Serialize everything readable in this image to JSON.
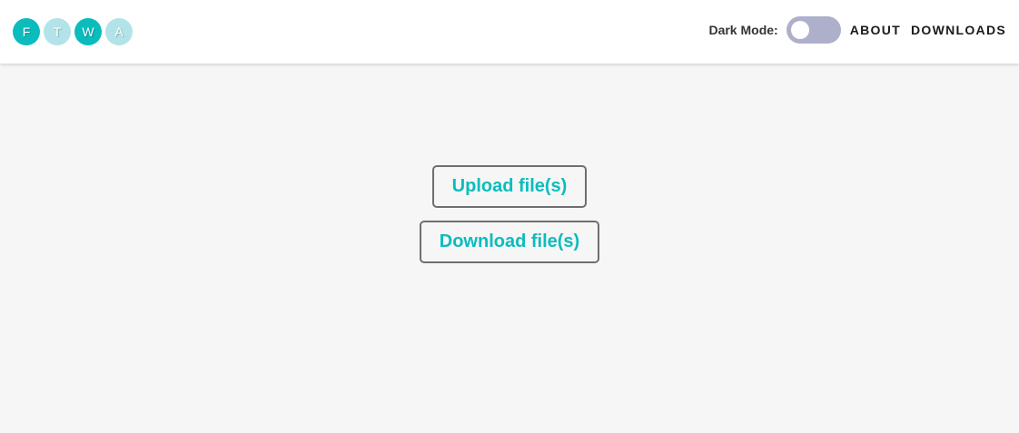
{
  "logo": {
    "letters": [
      "F",
      "T",
      "W",
      "A"
    ],
    "colors": [
      "#0bbcbd",
      "#b2e3e8"
    ]
  },
  "header": {
    "dark_mode_label": "Dark Mode:",
    "dark_mode_enabled": false,
    "nav": {
      "about": "ABOUT",
      "downloads": "DOWNLOADS"
    }
  },
  "main": {
    "upload_label": "Upload file(s)",
    "download_label": "Download file(s)"
  },
  "colors": {
    "accent": "#0bbcbd",
    "toggle_track": "#aeb0cb",
    "background": "#f6f6f6"
  }
}
